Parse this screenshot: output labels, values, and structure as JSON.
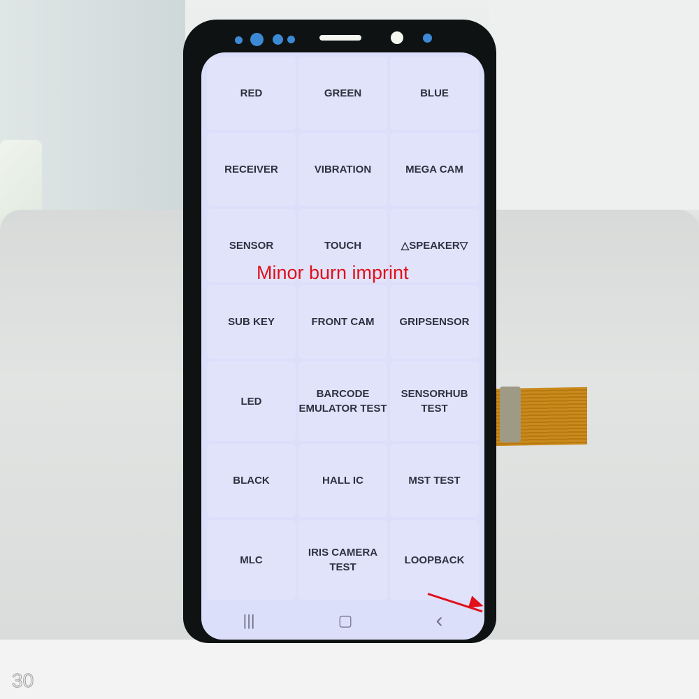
{
  "photo": {
    "subject": "Phone display panel with service test menu",
    "watermark": "30"
  },
  "test_menu": {
    "buttons": [
      "RED",
      "GREEN",
      "BLUE",
      "RECEIVER",
      "VIBRATION",
      "MEGA CAM",
      "SENSOR",
      "TOUCH",
      "△SPEAKER▽",
      "SUB KEY",
      "FRONT CAM",
      "GRIPSENSOR",
      "LED",
      "BARCODE EMULATOR TEST",
      "SENSORHUB TEST",
      "BLACK",
      "HALL IC",
      "MST TEST",
      "MLC",
      "IRIS CAMERA TEST",
      "LOOPBACK"
    ]
  },
  "navigation_bar": {
    "recents_icon": "|||",
    "home_icon": "▢",
    "back_icon": "‹"
  },
  "annotation": {
    "caption": "Minor burn imprint",
    "color": "#e0101a"
  }
}
